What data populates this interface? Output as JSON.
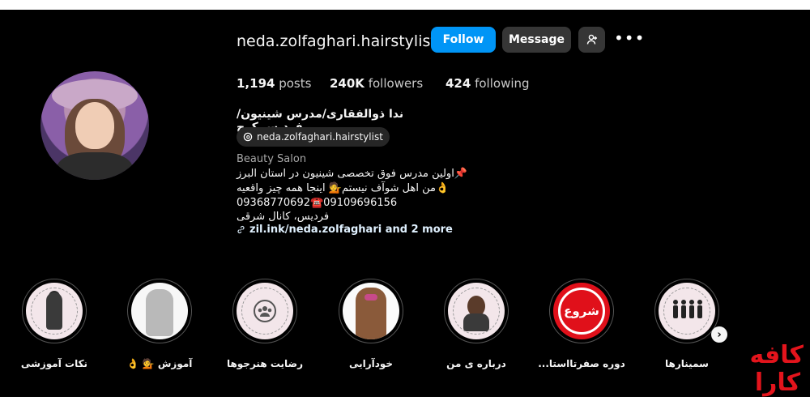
{
  "profile": {
    "handle": "neda.zolfaghari.hairstylist",
    "follow_label": "Follow",
    "message_label": "Message",
    "more_label": "•••",
    "adduser_icon": "add-user-icon",
    "stats": {
      "posts_count": "1,194",
      "posts_label": "posts",
      "followers_count": "240K",
      "followers_label": "followers",
      "following_count": "424",
      "following_label": "following"
    },
    "full_name": "ندا ذوالفقاری/مدرس شینیون/فردیس کرج",
    "threads_handle": "neda.zolfaghari.hairstylist",
    "category": "Beauty Salon",
    "bio": [
      "اولین مدرس فوق تخصصی شینیون در استان البرز📌",
      "من اهل شوآف نیستم💁 اینجا همه چیز واقعیه👌",
      "09368770692☎️09109696156",
      "فردیس، کانال شرقی"
    ],
    "link_text": "zil.ink/neda.zolfaghari and 2 more"
  },
  "highlights": [
    {
      "label": "نکات آموزشی"
    },
    {
      "label": "آموزش 💁 👌"
    },
    {
      "label": "رضایت هنرجوها"
    },
    {
      "label": "خودآرایی"
    },
    {
      "label": "درباره ی من"
    },
    {
      "label": "دوره صفرتااستا...",
      "badge": "شروع"
    },
    {
      "label": "سمینارها"
    }
  ],
  "watermark": [
    "کافه",
    "کارا"
  ],
  "colors": {
    "follow_button": "#0095f6",
    "secondary_button": "#363636",
    "background": "#000000",
    "watermark": "#e3141c"
  }
}
